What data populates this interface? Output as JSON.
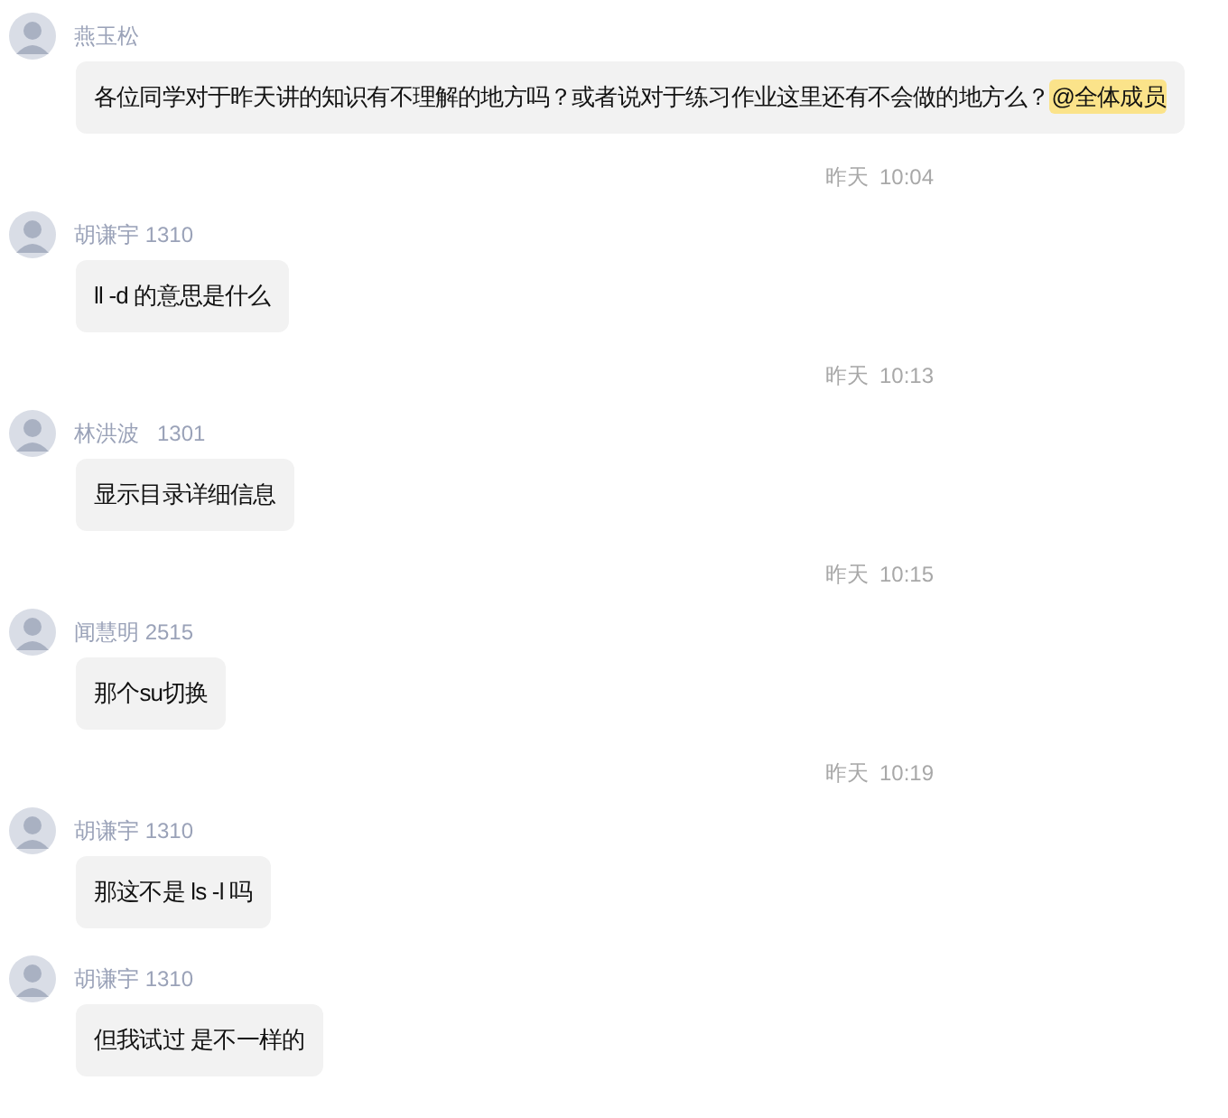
{
  "messages": [
    {
      "kind": "message",
      "sender": "燕玉松",
      "text": "各位同学对于昨天讲的知识有不理解的地方吗？或者说对于练习作业这里还有不会做的地方么？",
      "mention": "@全体成员"
    },
    {
      "kind": "time",
      "day": "昨天",
      "time": "10:04"
    },
    {
      "kind": "message",
      "sender": "胡谦宇 1310",
      "text": "ll -d 的意思是什么"
    },
    {
      "kind": "time",
      "day": "昨天",
      "time": "10:13"
    },
    {
      "kind": "message",
      "sender": "林洪波   1301",
      "text": "显示目录详细信息"
    },
    {
      "kind": "time",
      "day": "昨天",
      "time": "10:15"
    },
    {
      "kind": "message",
      "sender": "闻慧明 2515",
      "text": "那个su切换"
    },
    {
      "kind": "time",
      "day": "昨天",
      "time": "10:19"
    },
    {
      "kind": "message",
      "sender": "胡谦宇 1310",
      "text": "那这不是 ls -l 吗"
    },
    {
      "kind": "message",
      "sender": "胡谦宇 1310",
      "text": "但我试过 是不一样的"
    }
  ]
}
